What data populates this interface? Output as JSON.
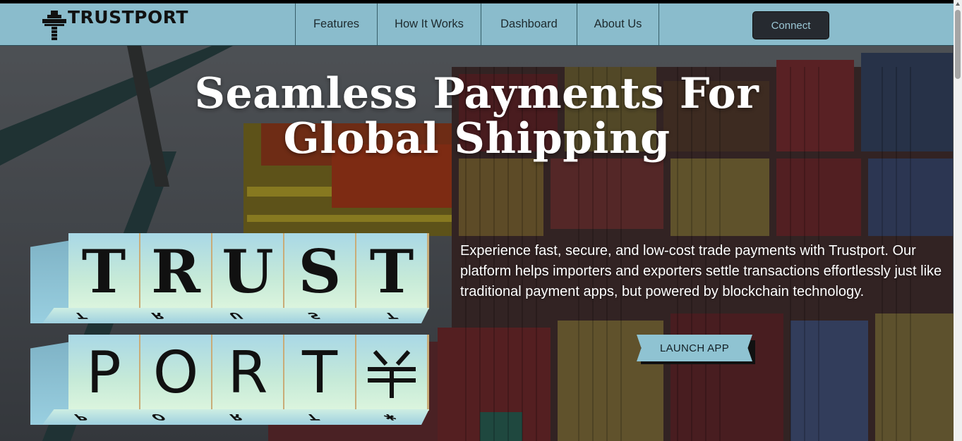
{
  "brand": {
    "name": "TRUSTPORT",
    "logo_icon": "ship-anchor-icon"
  },
  "nav": {
    "links": [
      "Features",
      "How It Works",
      "Dashboard",
      "About Us"
    ],
    "connect_label": "Connect"
  },
  "hero": {
    "title_line1": "Seamless Payments For",
    "title_line2": "Global Shipping",
    "description": "Experience fast, secure, and low-cost trade payments with Trustport. Our platform helps importers and exporters settle transactions effortlessly just like traditional payment apps, but powered by blockchain technology.",
    "launch_label": "LAUNCH APP",
    "background": "shipping-containers-port-photo",
    "blocks_row1": [
      "T",
      "R",
      "U",
      "S",
      "T"
    ],
    "blocks_row2": [
      "P",
      "O",
      "R",
      "T",
      "✱"
    ],
    "row2_last_icon": "stellar-logo-icon"
  },
  "colors": {
    "nav_bg": "#8abccc",
    "connect_bg": "#262a30",
    "launch_bg": "#8fc3d2",
    "block_face": "#c6ead8"
  }
}
